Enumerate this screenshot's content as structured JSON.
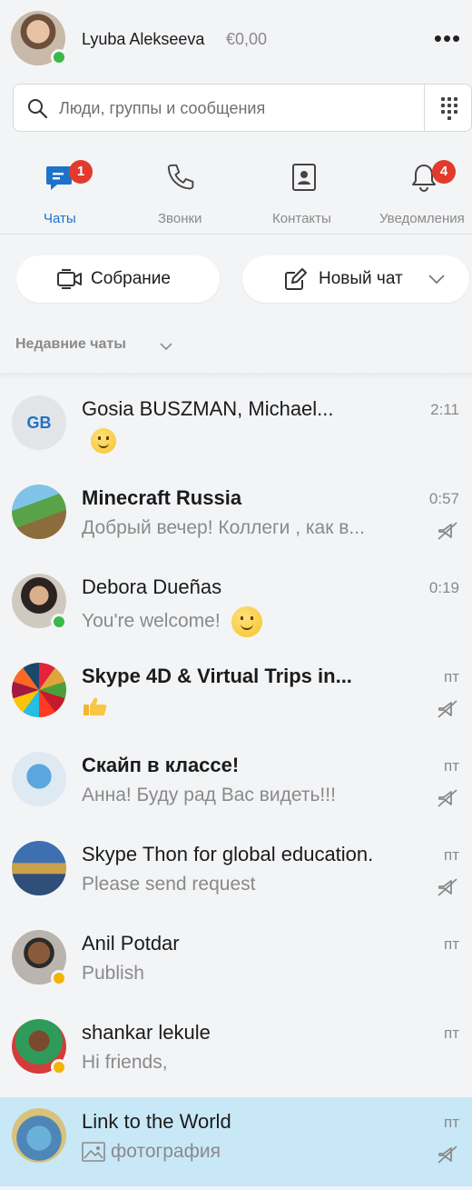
{
  "user": {
    "name": "Lyuba Alekseeva",
    "balance": "€0,00"
  },
  "header": {
    "more_label": "•••"
  },
  "search": {
    "placeholder": "Люди, группы и сообщения"
  },
  "tabs": [
    {
      "label": "Чаты",
      "badge": "1",
      "active": true,
      "icon": "chat-icon"
    },
    {
      "label": "Звонки",
      "badge": "",
      "active": false,
      "icon": "phone-icon"
    },
    {
      "label": "Контакты",
      "badge": "",
      "active": false,
      "icon": "contacts-icon"
    },
    {
      "label": "Уведомления",
      "badge": "4",
      "active": false,
      "icon": "bell-icon"
    }
  ],
  "actions": {
    "meeting_label": "Собрание",
    "new_chat_label": "Новый чат"
  },
  "recent": {
    "header": "Недавние чаты"
  },
  "chats": [
    {
      "name": "Gosia BUSZMAN, Michael...",
      "initials": "GB",
      "preview": "",
      "time": "2:11",
      "bold": false,
      "muted": false,
      "preview_emoji": "smile"
    },
    {
      "name": "Minecraft Russia",
      "preview": "Добрый вечер! Коллеги , как в...",
      "time": "0:57",
      "bold": true,
      "muted": true
    },
    {
      "name": "Debora Dueñas",
      "preview": "You're welcome!",
      "time": "0:19",
      "bold": false,
      "muted": false,
      "presence": "online",
      "preview_emoji": "smile"
    },
    {
      "name": "Skype 4D & Virtual Trips in...",
      "preview": "",
      "time": "пт",
      "bold": true,
      "muted": true,
      "preview_emoji": "thumbs-up"
    },
    {
      "name": " Скайп в классе!",
      "preview": "Анна! Буду рад Вас видеть!!!",
      "time": "пт",
      "bold": true,
      "muted": true
    },
    {
      "name": "Skype Thon for global education.",
      "preview": "Please send request",
      "time": "пт",
      "bold": false,
      "muted": true
    },
    {
      "name": "Anil Potdar",
      "preview": "Publish",
      "time": "пт",
      "bold": false,
      "muted": false,
      "presence": "away"
    },
    {
      "name": "shankar lekule",
      "preview": "Hi friends,",
      "time": "пт",
      "bold": false,
      "muted": false,
      "presence": "away"
    },
    {
      "name": "Link to the World",
      "preview": "фотография",
      "time": "пт",
      "bold": false,
      "muted": true,
      "selected": true
    }
  ],
  "colors": {
    "accent": "#1d73c8",
    "badge": "#e23a2d",
    "online": "#3cb74a",
    "away": "#f4b400",
    "selected_row": "#c8e8f8"
  }
}
